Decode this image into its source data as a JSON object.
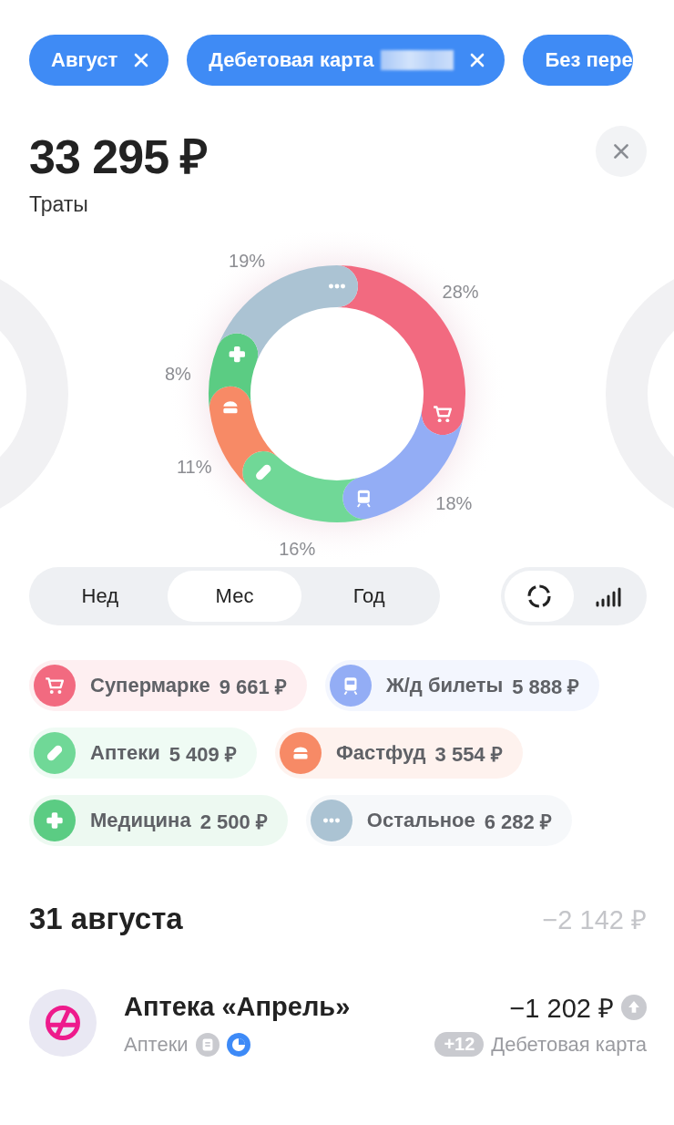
{
  "filters": [
    {
      "label": "Август",
      "closable": true,
      "redacted": false
    },
    {
      "label": "Дебетовая карта",
      "closable": true,
      "redacted": true
    },
    {
      "label": "Без пере",
      "closable": false,
      "redacted": false
    }
  ],
  "total": {
    "amount": "33 295 ₽",
    "label": "Траты"
  },
  "chart_data": {
    "type": "donut",
    "values": [
      28,
      18,
      16,
      11,
      8,
      19
    ],
    "value_labels": [
      "28%",
      "18%",
      "16%",
      "11%",
      "8%",
      "19%"
    ]
  },
  "periods": [
    {
      "label": "Нед",
      "selected": false
    },
    {
      "label": "Мес",
      "selected": true
    },
    {
      "label": "Год",
      "selected": false
    }
  ],
  "views": [
    {
      "kind": "donut",
      "selected": true
    },
    {
      "kind": "bars",
      "selected": false
    }
  ],
  "categories": [
    {
      "kind": "cart",
      "name": "Супермарке",
      "amount": "9 661 ₽",
      "color": "#f26a80"
    },
    {
      "kind": "train",
      "name": "Ж/д билеты",
      "amount": "5 888 ₽",
      "color": "#93adf5"
    },
    {
      "kind": "pill",
      "name": "Аптеки",
      "amount": "5 409 ₽",
      "color": "#70d897"
    },
    {
      "kind": "burger",
      "name": "Фастфуд",
      "amount": "3 554 ₽",
      "color": "#f78a66"
    },
    {
      "kind": "cross",
      "name": "Медицина",
      "amount": "2 500 ₽",
      "color": "#5bcc83"
    },
    {
      "kind": "dots",
      "name": "Остальное",
      "amount": "6 282 ₽",
      "color": "#abc3d3"
    }
  ],
  "day": {
    "date": "31 августа",
    "total": "−2 142 ₽",
    "transactions": [
      {
        "name": "Аптека «Апрель»",
        "amount": "−1 202 ₽",
        "category": "Аптеки",
        "badge": "+12",
        "account": "Дебетовая карта"
      }
    ]
  }
}
